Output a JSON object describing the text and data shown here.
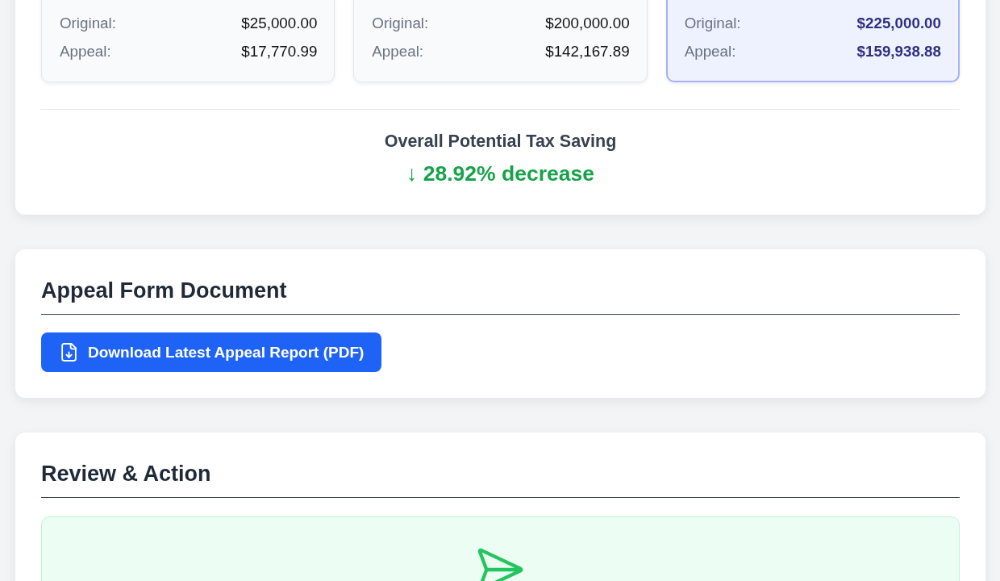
{
  "summary": {
    "cards": [
      {
        "highlighted": false,
        "rows": [
          {
            "label": "Original:",
            "value": "$25,000.00"
          },
          {
            "label": "Appeal:",
            "value": "$17,770.99"
          }
        ]
      },
      {
        "highlighted": false,
        "rows": [
          {
            "label": "Original:",
            "value": "$200,000.00"
          },
          {
            "label": "Appeal:",
            "value": "$142,167.89"
          }
        ]
      },
      {
        "highlighted": true,
        "rows": [
          {
            "label": "Original:",
            "value": "$225,000.00"
          },
          {
            "label": "Appeal:",
            "value": "$159,938.88"
          }
        ]
      }
    ],
    "overall": {
      "title": "Overall Potential Tax Saving",
      "change": "↓ 28.92% decrease"
    }
  },
  "appeal_form": {
    "title": "Appeal Form Document",
    "button": "Download Latest Appeal Report (PDF)"
  },
  "review": {
    "title": "Review & Action"
  }
}
